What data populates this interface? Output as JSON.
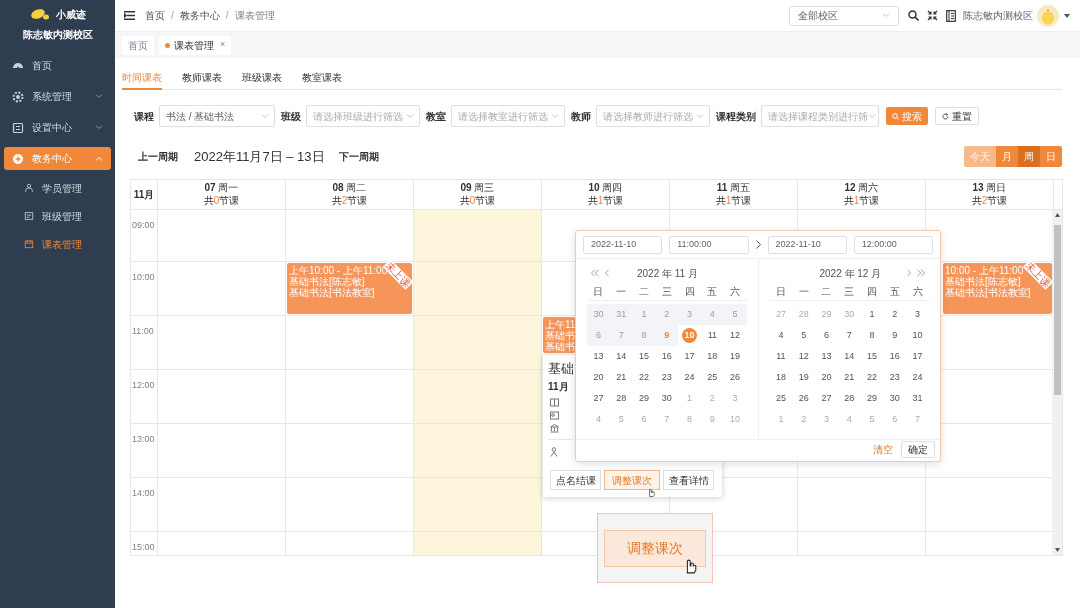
{
  "sidebar": {
    "brand": "小威迹",
    "campus": "陈志敏内测校区",
    "items": [
      {
        "label": "首页",
        "selected": false
      },
      {
        "label": "系统管理",
        "selected": false,
        "expanded": false
      },
      {
        "label": "设置中心",
        "selected": false,
        "expanded": false
      },
      {
        "label": "教务中心",
        "selected": true,
        "expanded": true,
        "children": [
          {
            "label": "学员管理",
            "selected": false
          },
          {
            "label": "班级管理",
            "selected": false
          },
          {
            "label": "课表管理",
            "selected": true
          }
        ]
      }
    ]
  },
  "header": {
    "breadcrumb": [
      "首页",
      "教务中心",
      "课表管理"
    ],
    "breadcrumb_separator": "/",
    "campus_select": {
      "value": "全部校区"
    },
    "user": "陈志敏内测校区"
  },
  "page_tabs": [
    {
      "label": "首页",
      "selected": false
    },
    {
      "label": "课表管理",
      "selected": true,
      "close": "×"
    }
  ],
  "view_tabs": [
    {
      "label": "时间课表",
      "selected": true
    },
    {
      "label": "教师课表",
      "selected": false
    },
    {
      "label": "班级课表",
      "selected": false
    },
    {
      "label": "教室课表",
      "selected": false
    }
  ],
  "filters": [
    {
      "label": "课程",
      "value": "书法 / 基础书法"
    },
    {
      "label": "班级",
      "placeholder": "请选择班级进行筛选"
    },
    {
      "label": "教室",
      "placeholder": "请选择教室进行筛选"
    },
    {
      "label": "教师",
      "placeholder": "请选择教师进行筛选"
    },
    {
      "label": "课程类别",
      "placeholder": "请选择课程类别进行筛"
    }
  ],
  "search_button": "搜索",
  "reset_button": "重置",
  "week_nav": {
    "prev": "上一周期",
    "title": "2022年11月7日 – 13日",
    "next": "下一周期"
  },
  "view_modes": [
    {
      "label": "今天",
      "selected": false,
      "disabled": true
    },
    {
      "label": "月",
      "selected": false,
      "disabled": false
    },
    {
      "label": "周",
      "selected": true,
      "disabled": false
    },
    {
      "label": "日",
      "selected": false,
      "disabled": false
    }
  ],
  "calendar": {
    "month": "11月",
    "days": [
      {
        "date": "07",
        "weekday": "周一",
        "count_prefix": "共",
        "count": "0",
        "count_suffix": "节课",
        "highlighted": false
      },
      {
        "date": "08",
        "weekday": "周二",
        "count_prefix": "共",
        "count": "2",
        "count_suffix": "节课",
        "highlighted": false
      },
      {
        "date": "09",
        "weekday": "周三",
        "count_prefix": "共",
        "count": "0",
        "count_suffix": "节课",
        "highlighted": true
      },
      {
        "date": "10",
        "weekday": "周四",
        "count_prefix": "共",
        "count": "1",
        "count_suffix": "节课",
        "highlighted": false
      },
      {
        "date": "11",
        "weekday": "周五",
        "count_prefix": "共",
        "count": "1",
        "count_suffix": "节课",
        "highlighted": false
      },
      {
        "date": "12",
        "weekday": "周六",
        "count_prefix": "共",
        "count": "1",
        "count_suffix": "节课",
        "highlighted": false
      },
      {
        "date": "13",
        "weekday": "周日",
        "count_prefix": "共",
        "count": "2",
        "count_suffix": "节课",
        "highlighted": false
      }
    ],
    "time_rows": [
      {
        "time": "09:00",
        "cells": [
          null,
          null,
          null,
          null,
          null,
          null,
          null
        ]
      },
      {
        "time": "10:00",
        "cells": [
          null,
          {
            "lines": [
              "上午10:00 - 上午11:00",
              "基础书法[陈志敏]",
              "基础书法[书法教室]"
            ],
            "ribbon": "未上课",
            "kind": "whole"
          },
          null,
          null,
          null,
          null,
          {
            "lines": [
              "10:00 - 上午11:00",
              "基础书法[陈志敏]",
              "基础书法[书法教室]"
            ],
            "ribbon": "未上课",
            "kind": "leftcut"
          }
        ]
      },
      {
        "time": "11:00",
        "cells": [
          null,
          null,
          null,
          {
            "lines": [
              "上午11",
              "基础书",
              "基础书"
            ],
            "kind": "rightcut"
          },
          null,
          null,
          null
        ]
      },
      {
        "time": "12:00",
        "cells": [
          null,
          null,
          null,
          null,
          null,
          null,
          null
        ]
      },
      {
        "time": "13:00",
        "cells": [
          null,
          null,
          null,
          null,
          null,
          null,
          null
        ]
      },
      {
        "time": "14:00",
        "cells": [
          null,
          null,
          null,
          null,
          null,
          null,
          null
        ]
      },
      {
        "time": "15:00",
        "cells": [
          null,
          null,
          null,
          null,
          null,
          null,
          null
        ]
      }
    ]
  },
  "lesson_popover": {
    "title": "基础",
    "date": "11月",
    "actions": [
      {
        "label": "点名结课",
        "selected": false
      },
      {
        "label": "调整课次",
        "selected": true
      },
      {
        "label": "查看详情",
        "selected": false
      }
    ]
  },
  "date_picker": {
    "start_date": "2022-11-10",
    "start_time": "11:00:00",
    "end_date": "2022-11-10",
    "end_time": "12:00:00",
    "months": [
      {
        "title": "2022 年 11 月",
        "weekdays": [
          "日",
          "一",
          "二",
          "三",
          "四",
          "五",
          "六"
        ],
        "weeks": [
          [
            {
              "d": "30",
              "kind": "disabled"
            },
            {
              "d": "31",
              "kind": "disabled"
            },
            {
              "d": "1",
              "kind": "disabled"
            },
            {
              "d": "2",
              "kind": "disabled"
            },
            {
              "d": "3",
              "kind": "disabled"
            },
            {
              "d": "4",
              "kind": "disabled"
            },
            {
              "d": "5",
              "kind": "disabled"
            }
          ],
          [
            {
              "d": "6",
              "kind": "disabled"
            },
            {
              "d": "7",
              "kind": "disabled"
            },
            {
              "d": "8",
              "kind": "disabled"
            },
            {
              "d": "9",
              "kind": "today"
            },
            {
              "d": "10",
              "kind": "selected"
            },
            {
              "d": "11",
              "kind": "current"
            },
            {
              "d": "12",
              "kind": "current"
            }
          ],
          [
            {
              "d": "13",
              "kind": "current"
            },
            {
              "d": "14",
              "kind": "current"
            },
            {
              "d": "15",
              "kind": "current"
            },
            {
              "d": "16",
              "kind": "current"
            },
            {
              "d": "17",
              "kind": "current"
            },
            {
              "d": "18",
              "kind": "current"
            },
            {
              "d": "19",
              "kind": "current"
            }
          ],
          [
            {
              "d": "20",
              "kind": "current"
            },
            {
              "d": "21",
              "kind": "current"
            },
            {
              "d": "22",
              "kind": "current"
            },
            {
              "d": "23",
              "kind": "current"
            },
            {
              "d": "24",
              "kind": "current"
            },
            {
              "d": "25",
              "kind": "current"
            },
            {
              "d": "26",
              "kind": "current"
            }
          ],
          [
            {
              "d": "27",
              "kind": "current"
            },
            {
              "d": "28",
              "kind": "current"
            },
            {
              "d": "29",
              "kind": "current"
            },
            {
              "d": "30",
              "kind": "current"
            },
            {
              "d": "1",
              "kind": "other"
            },
            {
              "d": "2",
              "kind": "other"
            },
            {
              "d": "3",
              "kind": "other"
            }
          ],
          [
            {
              "d": "4",
              "kind": "other"
            },
            {
              "d": "5",
              "kind": "other"
            },
            {
              "d": "6",
              "kind": "other"
            },
            {
              "d": "7",
              "kind": "other"
            },
            {
              "d": "8",
              "kind": "other"
            },
            {
              "d": "9",
              "kind": "other"
            },
            {
              "d": "10",
              "kind": "other"
            }
          ]
        ]
      },
      {
        "title": "2022 年 12 月",
        "weekdays": [
          "日",
          "一",
          "二",
          "三",
          "四",
          "五",
          "六"
        ],
        "weeks": [
          [
            {
              "d": "27",
              "kind": "other"
            },
            {
              "d": "28",
              "kind": "other"
            },
            {
              "d": "29",
              "kind": "other"
            },
            {
              "d": "30",
              "kind": "other"
            },
            {
              "d": "1",
              "kind": "current"
            },
            {
              "d": "2",
              "kind": "current"
            },
            {
              "d": "3",
              "kind": "current"
            }
          ],
          [
            {
              "d": "4",
              "kind": "current"
            },
            {
              "d": "5",
              "kind": "current"
            },
            {
              "d": "6",
              "kind": "current"
            },
            {
              "d": "7",
              "kind": "current"
            },
            {
              "d": "8",
              "kind": "current"
            },
            {
              "d": "9",
              "kind": "current"
            },
            {
              "d": "10",
              "kind": "current"
            }
          ],
          [
            {
              "d": "11",
              "kind": "current"
            },
            {
              "d": "12",
              "kind": "current"
            },
            {
              "d": "13",
              "kind": "current"
            },
            {
              "d": "14",
              "kind": "current"
            },
            {
              "d": "15",
              "kind": "current"
            },
            {
              "d": "16",
              "kind": "current"
            },
            {
              "d": "17",
              "kind": "current"
            }
          ],
          [
            {
              "d": "18",
              "kind": "current"
            },
            {
              "d": "19",
              "kind": "current"
            },
            {
              "d": "20",
              "kind": "current"
            },
            {
              "d": "21",
              "kind": "current"
            },
            {
              "d": "22",
              "kind": "current"
            },
            {
              "d": "23",
              "kind": "current"
            },
            {
              "d": "24",
              "kind": "current"
            }
          ],
          [
            {
              "d": "25",
              "kind": "current"
            },
            {
              "d": "26",
              "kind": "current"
            },
            {
              "d": "27",
              "kind": "current"
            },
            {
              "d": "28",
              "kind": "current"
            },
            {
              "d": "29",
              "kind": "current"
            },
            {
              "d": "30",
              "kind": "current"
            },
            {
              "d": "31",
              "kind": "current"
            }
          ],
          [
            {
              "d": "1",
              "kind": "other"
            },
            {
              "d": "2",
              "kind": "other"
            },
            {
              "d": "3",
              "kind": "other"
            },
            {
              "d": "4",
              "kind": "other"
            },
            {
              "d": "5",
              "kind": "other"
            },
            {
              "d": "6",
              "kind": "other"
            },
            {
              "d": "7",
              "kind": "other"
            }
          ]
        ]
      }
    ],
    "clear": "清空",
    "confirm": "确定"
  },
  "zoom_inset": {
    "label": "调整课次"
  }
}
